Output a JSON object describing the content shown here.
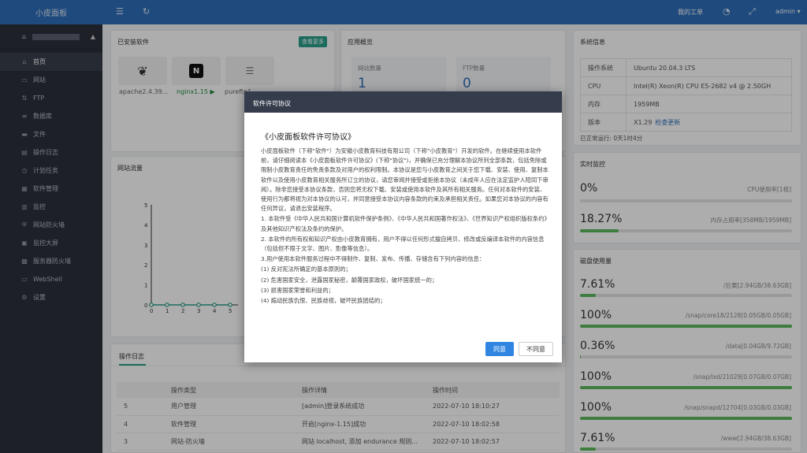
{
  "header": {
    "logo": "小皮面板",
    "my_orders": "我的工单",
    "user": "admin"
  },
  "sidebar": {
    "items": [
      {
        "label": "首页",
        "icon": "home-icon"
      },
      {
        "label": "网站",
        "icon": "monitor-icon"
      },
      {
        "label": "FTP",
        "icon": "ftp-icon"
      },
      {
        "label": "数据库",
        "icon": "database-icon"
      },
      {
        "label": "文件",
        "icon": "folder-icon"
      },
      {
        "label": "操作日志",
        "icon": "log-icon"
      },
      {
        "label": "计划任务",
        "icon": "clock-icon"
      },
      {
        "label": "软件管理",
        "icon": "grid-icon"
      },
      {
        "label": "监控",
        "icon": "chart-icon"
      },
      {
        "label": "网站防火墙",
        "icon": "shield-icon"
      },
      {
        "label": "监控大屏",
        "icon": "screen-icon"
      },
      {
        "label": "服务器防火墙",
        "icon": "firewall-icon"
      },
      {
        "label": "WebShell",
        "icon": "terminal-icon"
      },
      {
        "label": "设置",
        "icon": "gear-icon"
      }
    ]
  },
  "installed": {
    "title": "已安装软件",
    "more": "查看更多",
    "items": [
      {
        "name": "apache2.4.39..."
      },
      {
        "name": "nginx1.15"
      },
      {
        "name": "pureftp1.0.4"
      }
    ]
  },
  "overview": {
    "title": "应用概览",
    "site_label": "网站数量",
    "site_value": "1",
    "ftp_label": "FTP数量",
    "ftp_value": "0"
  },
  "sysinfo": {
    "title": "系统信息",
    "rows": [
      {
        "k": "操作系统",
        "v": "Ubuntu 20.04.3 LTS"
      },
      {
        "k": "CPU",
        "v": "Intel(R) Xeon(R) CPU E5-2682 v4 @ 2.50GH"
      },
      {
        "k": "内存",
        "v": "1959MB"
      },
      {
        "k": "版本",
        "v": "X1.29"
      }
    ],
    "check_update": "检查更新",
    "uptime": "已正常运行: 0天1时4分"
  },
  "realtime": {
    "title": "实时监控",
    "cpu_pct": "0%",
    "cpu_info": "CPU使用率[1核]",
    "cpu_fill": 0.0,
    "mem_pct": "18.27%",
    "mem_info": "内存占用率[358MB/1959MB]",
    "mem_fill": 0.1827
  },
  "disk": {
    "title": "磁盘使用量",
    "items": [
      {
        "pct": "7.61%",
        "info": "/巨栗[2.94GB/38.63GB]",
        "fill": 0.0761
      },
      {
        "pct": "100%",
        "info": "/snap/core18/2128[0.05GB/0.05GB]",
        "fill": 1
      },
      {
        "pct": "0.36%",
        "info": "/data[0.04GB/9.72GB]",
        "fill": 0.0036
      },
      {
        "pct": "100%",
        "info": "/snap/lxd/21029[0.07GB/0.07GB]",
        "fill": 1
      },
      {
        "pct": "100%",
        "info": "/snap/snapd/12704[0.03GB/0.03GB]",
        "fill": 1
      },
      {
        "pct": "7.61%",
        "info": "/www[2.94GB/38.63GB]",
        "fill": 0.0761
      }
    ]
  },
  "traffic": {
    "title": "网站流量"
  },
  "chart_data": {
    "type": "line",
    "x": [
      0,
      1,
      2,
      3,
      4,
      5
    ],
    "series": [
      {
        "values": [
          0,
          0,
          0,
          0,
          0,
          0
        ]
      }
    ],
    "yticks": [
      0,
      1,
      2,
      3,
      4,
      5
    ],
    "ylim": [
      0,
      5
    ],
    "title": "",
    "xlabel": "",
    "ylabel": ""
  },
  "oplog": {
    "tab": "操作日志",
    "headers": [
      "",
      "操作类型",
      "操作详情",
      "操作时间"
    ],
    "rows": [
      [
        "5",
        "用户管理",
        "[admin]登录系统成功",
        "2022-07-10 18:10:27"
      ],
      [
        "4",
        "软件管理",
        "开启[nginx-1.15]成功",
        "2022-07-10 18:02:58"
      ],
      [
        "3",
        "网站-防火墙",
        "网站 localhost, 添加 endurance 规则...",
        "2022-07-10 18:02:57"
      ]
    ]
  },
  "modal": {
    "header": "软件许可协议",
    "doc_title": "《小皮面板软件许可协议》",
    "paragraphs": [
      "小皮面板软件（下称\"软件\"）为安徽小皮教育科技有限公司（下称\"小皮教育\"）开发的软件。在继续使用本软件前，请仔细阅读本《小皮面板软件许可协议》(下称\"协议\")，并确保已充分理解本协议所列全部条款，包括免除或限制小皮教育责任的免责条款及对用户的权利限制。本协议是您与小皮教育之间关于您下载、安装、使用、复制本软件以及使用小皮教育相关服务所订立的协议，请您审阅并接受或拒绝本协议（未成年人应在法定监护人陪同下审阅）。除非您接受本协议条款，否则您将无权下载、安装或使用本软件及其所有相关服务。任何对本软件的安装、使用行为都将视为对本协议的认可，并同意接受本协议内容条款的约束及承担相关责任。如果您对本协议的内容有任何异议，请退出安装程序。",
      "1. 本软件受《中华人民共和国计算机软件保护条例》、《中华人民共和国著作权法》、《世界知识产权组织版权条约》及其他知识产权法及条约的保护。",
      "2. 本软件的所有权和知识产权由小皮教育拥有，用户不得以任何形式擅自拷贝、修改或反编译本软件的内容信息（包括但不限于文字、图片、影像等信息）。",
      "3.用户使用本软件服务过程中不得制作、复制、发布、传播、存储含有下列内容的信息：",
      "(1) 反对宪法所确定的基本原则的；",
      "(2) 危害国家安全，泄露国家秘密，颠覆国家政权，破坏国家统一的；",
      "(3) 损害国家荣誉和利益的；",
      "(4) 煽动民族仇恨、民族歧视，破坏民族团结的；"
    ],
    "agree": "同意",
    "disagree": "不同意"
  }
}
